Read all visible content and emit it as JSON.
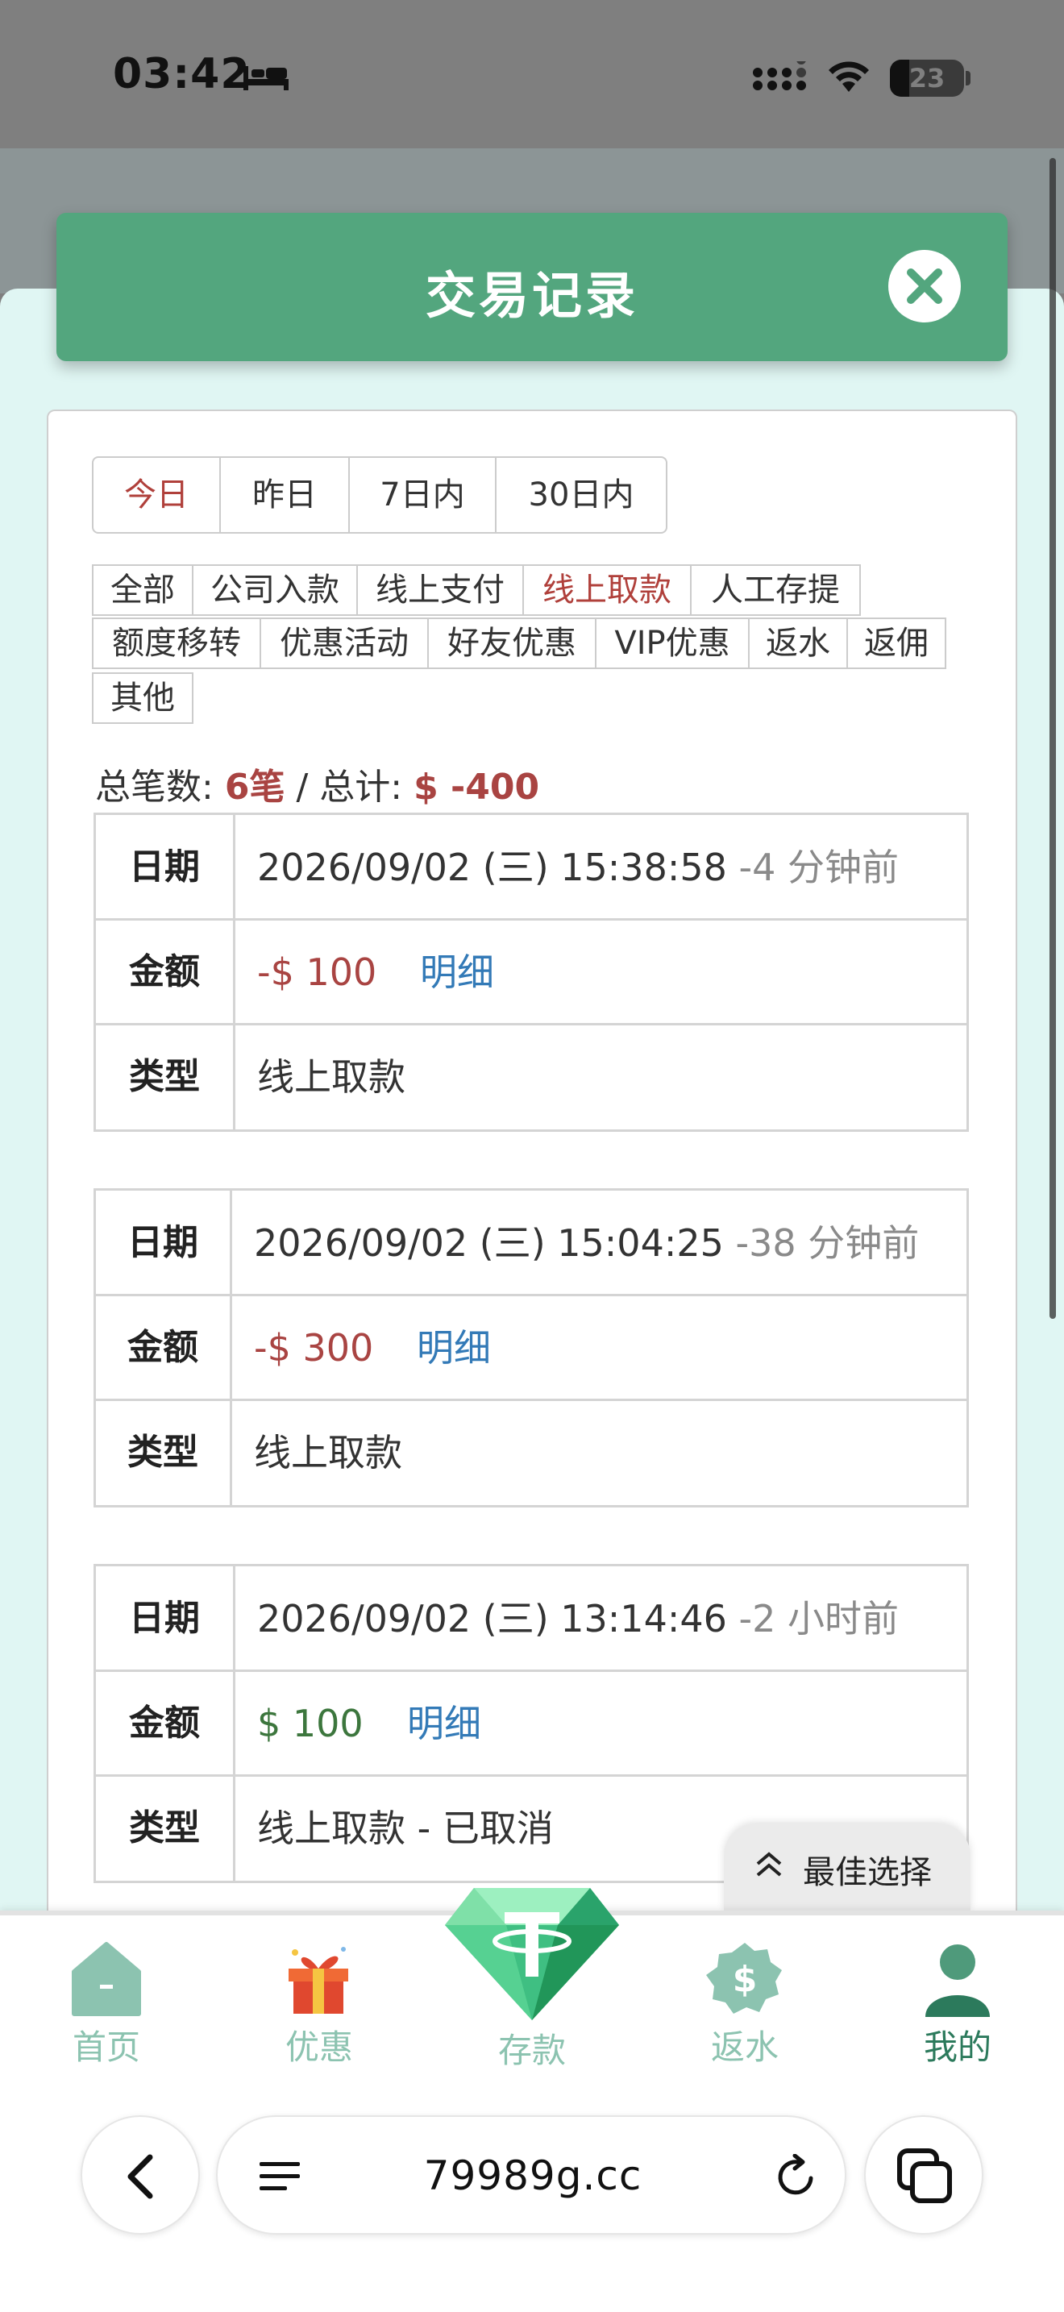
{
  "status_bar": {
    "time": "03:42",
    "battery": "23"
  },
  "modal": {
    "title": "交易记录"
  },
  "date_tabs": [
    "今日",
    "昨日",
    "7日内",
    "30日内"
  ],
  "date_tab_active": "今日",
  "type_filters": [
    "全部",
    "公司入款",
    "线上支付",
    "线上取款",
    "人工存提",
    "额度移转",
    "优惠活动",
    "好友优惠",
    "VIP优惠",
    "返水",
    "返佣",
    "其他"
  ],
  "type_filter_active": "线上取款",
  "summary": {
    "count_label": "总笔数:",
    "count": "6笔",
    "sep": " / ",
    "total_label": "总计:",
    "total": "$ -400"
  },
  "labels": {
    "date": "日期",
    "amount": "金额",
    "type": "类型",
    "detail": "明细"
  },
  "records": [
    {
      "date": "2026/09/02 (三) 15:38:58",
      "ago": "-4 分钟前",
      "amount": "-$ 100",
      "type": "线上取款"
    },
    {
      "date": "2026/09/02 (三) 15:04:25",
      "ago": "-38 分钟前",
      "amount": "-$ 300",
      "type": "线上取款"
    },
    {
      "date": "2026/09/02 (三) 13:14:46",
      "ago": "-2 小时前",
      "amount": "$ 100",
      "type": "线上取款 - 已取消"
    }
  ],
  "best_choice": "最佳选择",
  "nav": [
    {
      "label": "首页",
      "icon": "home-icon"
    },
    {
      "label": "优惠",
      "icon": "gift-icon"
    },
    {
      "label": "存款",
      "icon": "diamond-tether-icon"
    },
    {
      "label": "返水",
      "icon": "dollar-badge-icon"
    },
    {
      "label": "我的",
      "icon": "user-icon"
    }
  ],
  "browser": {
    "url": "79989g.cc"
  },
  "colors": {
    "header": "#53a67e",
    "accent_red": "#a94442",
    "accent_green": "#3c763d",
    "link_blue": "#337ab7",
    "nav_label": "#8cc3b0"
  }
}
